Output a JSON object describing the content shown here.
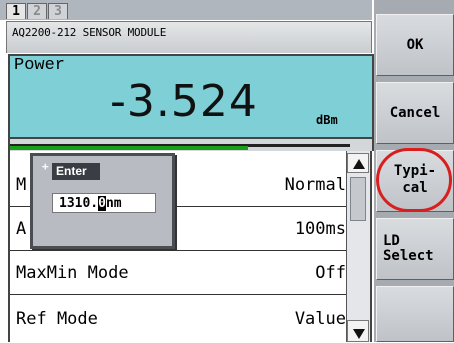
{
  "tabs": [
    "1",
    "2",
    "3"
  ],
  "module_name": "AQ2200-212 SENSOR MODULE",
  "power": {
    "label": "Power",
    "value": "-3.524",
    "unit": "dBm",
    "bar_fraction": 0.7
  },
  "settings": [
    {
      "label": "M",
      "value": "Normal"
    },
    {
      "label": "A",
      "value": "100ms"
    },
    {
      "label": "MaxMin Mode",
      "value": "Off"
    },
    {
      "label": "Ref Mode",
      "value": "Value"
    }
  ],
  "popup": {
    "marker": "+",
    "title": "Enter",
    "value_before_cursor": "1310.",
    "cursor_char": "0",
    "value_after_cursor": "nm"
  },
  "softkeys": {
    "ok": "OK",
    "cancel": "Cancel",
    "typical_line1": "Typi-",
    "typical_line2": "cal",
    "ld_line1": "LD",
    "ld_line2": "Select"
  },
  "colors": {
    "power_panel": "#7ecfd6",
    "progress_bar": "#18a018",
    "highlight_ring": "#d81e1e"
  }
}
